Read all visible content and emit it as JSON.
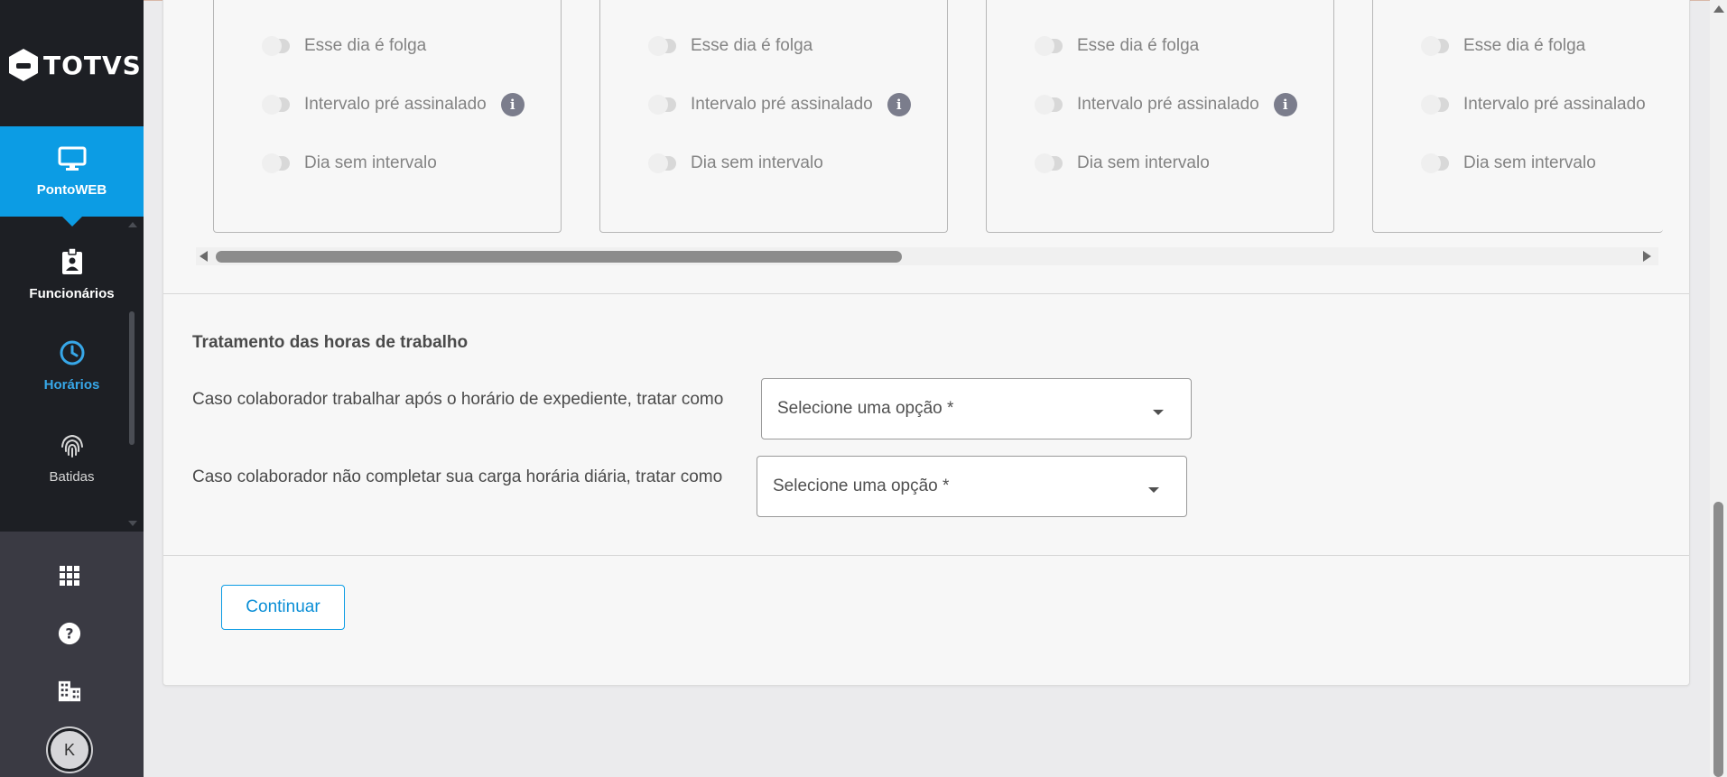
{
  "brand": {
    "logo_text": "TOTVS"
  },
  "sidebar": {
    "items": [
      {
        "label": "PontoWEB",
        "icon": "monitor-icon"
      },
      {
        "label": "Funcionários",
        "icon": "badge-icon"
      },
      {
        "label": "Horários",
        "icon": "clock-icon"
      },
      {
        "label": "Batidas",
        "icon": "fingerprint-icon"
      }
    ],
    "bottom_icons": [
      "apps-grid-icon",
      "help-icon",
      "building-icon"
    ],
    "avatar_initial": "K"
  },
  "day_cards": [
    {
      "rows": [
        "Esse dia é folga",
        "Intervalo pré assinalado",
        "Dia sem intervalo"
      ]
    },
    {
      "rows": [
        "Esse dia é folga",
        "Intervalo pré assinalado",
        "Dia sem intervalo"
      ]
    },
    {
      "rows": [
        "Esse dia é folga",
        "Intervalo pré assinalado",
        "Dia sem intervalo"
      ]
    },
    {
      "rows": [
        "Esse dia é folga",
        "Intervalo pré assinalado",
        "Dia sem intervalo"
      ]
    }
  ],
  "work_hours": {
    "title": "Tratamento das horas de trabalho",
    "q1_label": "Caso colaborador trabalhar após o horário de expediente, tratar como",
    "q1_placeholder": "Selecione uma opção *",
    "q2_label": "Caso colaborador não completar sua carga horária diária, tratar como",
    "q2_placeholder": "Selecione uma opção *"
  },
  "actions": {
    "continue_label": "Continuar"
  },
  "colors": {
    "accent": "#0c9ce4",
    "sidebar": "#1d1f24",
    "sidebar_bottom": "#3a3a43"
  }
}
